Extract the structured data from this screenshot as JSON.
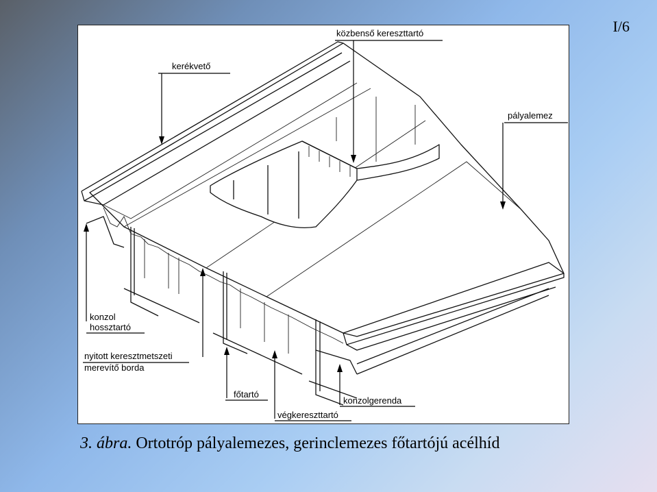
{
  "page_number": "I/6",
  "labels": {
    "cross_girder_intermediate": "közbenső kereszttartó",
    "wheel_guard": "kerékvető",
    "deck_plate": "pályalemez",
    "cantilever": "konzol",
    "longitudinal": "hossztartó",
    "open_stiffener_line1": "nyitott keresztmetszeti",
    "open_stiffener_line2": "merevítő borda",
    "main_girder": "főtartó",
    "cantilever_beam": "konzolgerenda",
    "end_cross_girder": "végkereszttartó"
  },
  "caption": {
    "number": "3. ábra.",
    "text": "Ortotróp pályalemezes, gerinclemezes főtartójú acélhíd"
  }
}
